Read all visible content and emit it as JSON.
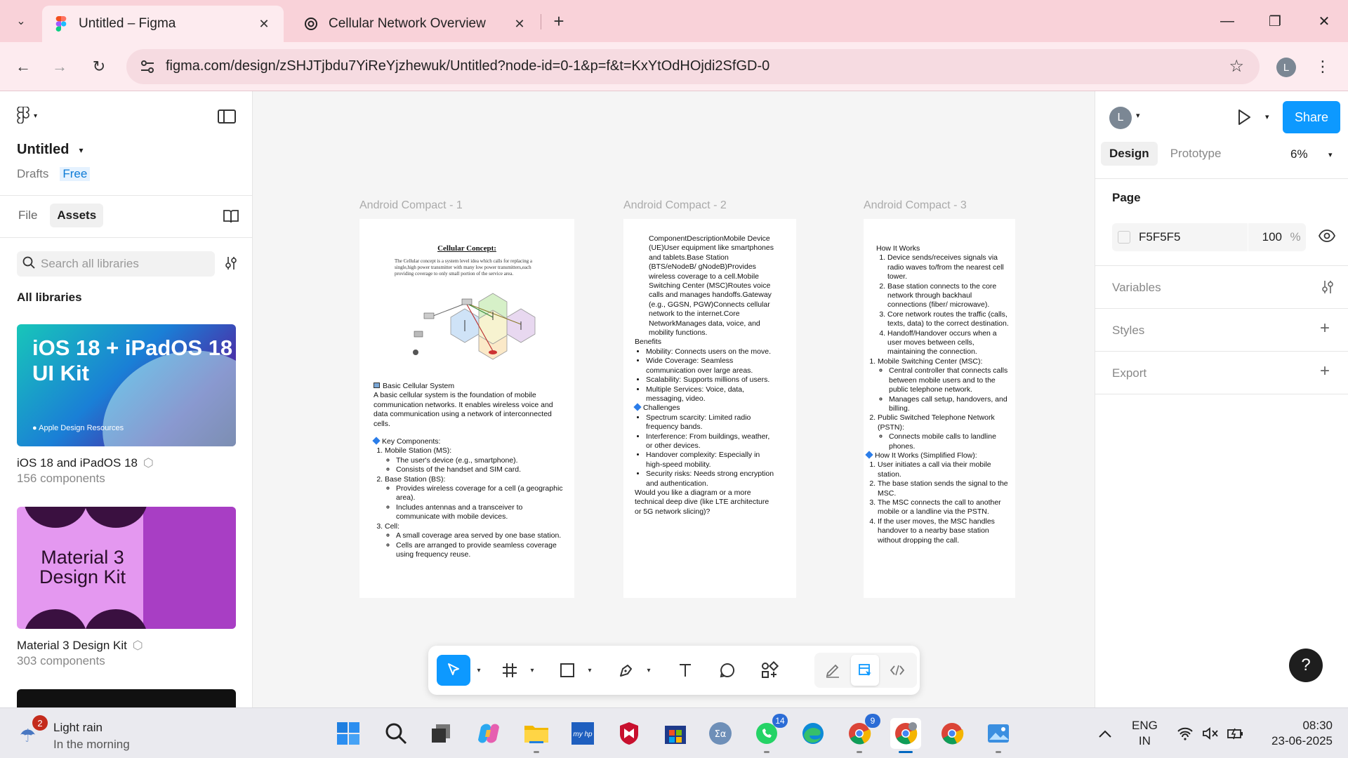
{
  "browser": {
    "tabs": [
      {
        "title": "Untitled – Figma",
        "active": true,
        "icon": "figma-icon"
      },
      {
        "title": "Cellular Network Overview",
        "active": false,
        "icon": "chatgpt-icon"
      }
    ],
    "url": "figma.com/design/zSHJTjbdu7YiReYjzhewuk/Untitled?node-id=0-1&p=f&t=KxYtOdHOjdi2SfGD-0",
    "profile_initial": "L"
  },
  "left_panel": {
    "file_name": "Untitled",
    "location": "Drafts",
    "plan": "Free",
    "tabs": [
      "File",
      "Assets"
    ],
    "active_tab": "Assets",
    "search_placeholder": "Search all libraries",
    "section_title": "All libraries",
    "libraries": [
      {
        "card_title": "iOS 18 + iPadOS 18 UI Kit",
        "card_line1": "iOS 18 + iPadOS 18",
        "card_line2": "UI Kit",
        "card_sub": "Apple Design Resources",
        "name": "iOS 18 and iPadOS 18",
        "count": "156 components"
      },
      {
        "card_line1": "Material 3",
        "card_line2": "Design Kit",
        "name": "Material 3 Design Kit",
        "count": "303 components"
      }
    ]
  },
  "canvas": {
    "frames": [
      {
        "label": "Android Compact - 1",
        "image_title": "Cellular Concept:",
        "image_paragraph": "The Cellular concept is a system level idea which calls for replacing a single,high power transmitter with many low power transmitters,each providing coverage to only small portion of the service area.",
        "heading": "Basic Cellular System",
        "intro": "A basic cellular system is the foundation of mobile communication networks. It enables wireless voice and data communication using a network of interconnected cells.",
        "key_components_title": "Key Components:",
        "components": [
          {
            "name": "Mobile Station (MS):",
            "items": [
              "The user's device (e.g., smartphone).",
              "Consists of the handset and SIM card."
            ]
          },
          {
            "name": "Base Station (BS):",
            "items": [
              "Provides wireless coverage for a cell (a geographic area).",
              "Includes antennas and a transceiver to communicate with mobile devices."
            ]
          },
          {
            "name": "Cell:",
            "items": [
              "A small coverage area served by one base station.",
              "Cells are arranged to provide seamless coverage using frequency reuse."
            ]
          }
        ]
      },
      {
        "label": "Android Compact - 2",
        "table_text": "ComponentDescriptionMobile Device (UE)User equipment like smartphones and tablets.Base Station (BTS/eNodeB/ gNodeB)Provides wireless coverage to a cell.Mobile Switching Center (MSC)Routes voice calls and manages handoffs.Gateway (e.g., GGSN, PGW)Connects cellular network to the internet.Core NetworkManages data, voice, and mobility functions.",
        "benefits_title": "Benefits",
        "benefits": [
          "Mobility: Connects users on the move.",
          "Wide Coverage: Seamless communication over large areas.",
          "Scalability: Supports millions of users.",
          "Multiple Services: Voice, data, messaging, video."
        ],
        "challenges_title": "Challenges",
        "challenges": [
          "Spectrum scarcity: Limited radio frequency bands.",
          "Interference: From buildings, weather, or other devices.",
          "Handover complexity: Especially in high-speed mobility.",
          "Security risks: Needs strong encryption and authentication."
        ],
        "closing": "Would you like a diagram or a more technical deep dive (like LTE architecture or 5G network slicing)?"
      },
      {
        "label": "Android Compact - 3",
        "how_title": "How It Works",
        "how_steps": [
          "Device sends/receives signals via radio waves to/from the nearest cell tower.",
          "Base station connects to the core network through backhaul connections (fiber/ microwave).",
          "Core network routes the traffic (calls, texts, data) to the correct destination.",
          "Handoff/Handover occurs when a user moves between cells, maintaining the connection."
        ],
        "components": [
          {
            "name": "Mobile Switching Center (MSC):",
            "items": [
              "Central controller that connects calls between mobile users and to the public telephone network.",
              "Manages call setup, handovers, and billing."
            ]
          },
          {
            "name": "Public Switched Telephone Network (PSTN):",
            "items": [
              "Connects mobile calls to landline phones."
            ]
          }
        ],
        "flow_title": "How It Works (Simplified Flow):",
        "flow_steps": [
          "User initiates a call via their mobile station.",
          "The base station sends the signal to the MSC.",
          "The MSC connects the call to another mobile or a landline via the PSTN.",
          "If the user moves, the MSC handles handover to a nearby base station without dropping the call."
        ]
      }
    ]
  },
  "toolbar": {
    "tools": [
      "move-tool",
      "frame-tool",
      "rectangle-tool",
      "pen-tool",
      "text-tool",
      "comment-tool",
      "actions-tool"
    ],
    "modes": [
      "draw-mode",
      "design-mode",
      "dev-mode"
    ]
  },
  "right_panel": {
    "avatar_initial": "L",
    "share_label": "Share",
    "tabs": [
      "Design",
      "Prototype"
    ],
    "active_tab": "Design",
    "zoom": "6%",
    "page_title": "Page",
    "page_color": "F5F5F5",
    "page_opacity": "100",
    "page_opacity_unit": "%",
    "variables_label": "Variables",
    "styles_label": "Styles",
    "export_label": "Export",
    "help_label": "?"
  },
  "taskbar": {
    "weather_badge": "2",
    "weather_line1": "Light rain",
    "weather_line2": "In the morning",
    "whatsapp_badge": "14",
    "chrome_badge": "9",
    "lang_line1": "ENG",
    "lang_line2": "IN",
    "time": "08:30",
    "date": "23-06-2025"
  },
  "colors": {
    "accent": "#0d99ff",
    "tabbar": "#f9d2d9",
    "toolbar_bg": "#fdebef"
  }
}
